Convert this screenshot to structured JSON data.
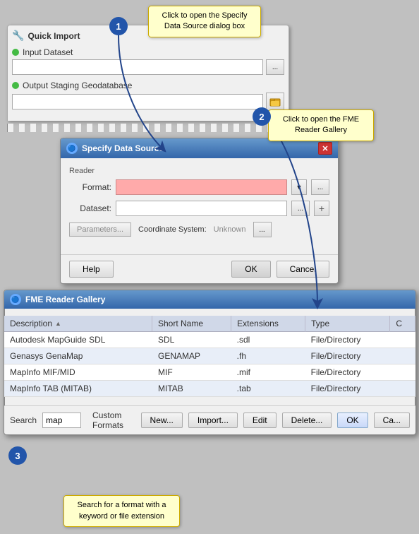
{
  "quickImport": {
    "title": "Quick Import",
    "inputDatasetLabel": "Input Dataset",
    "outputStagingLabel": "Output Staging Geodatabase",
    "browseBtnLabel": "...",
    "iconBtnLabel": "📁"
  },
  "tooltip1": {
    "text": "Click to open the Specify Data Source dialog box"
  },
  "tooltip2": {
    "text": "Click to open the FME Reader Gallery"
  },
  "tooltip3": {
    "text": "Search for a format with a keyword or file extension"
  },
  "specifyDialog": {
    "title": "Specify Data Source",
    "readerLabel": "Reader",
    "formatLabel": "Format:",
    "datasetLabel": "Dataset:",
    "paramsBtnLabel": "Parameters...",
    "coordinateSystemLabel": "Coordinate System:",
    "coordinateSystemValue": "Unknown",
    "browseBtnLabel": "...",
    "helpBtnLabel": "Help",
    "okBtnLabel": "OK",
    "cancelBtnLabel": "Cancel"
  },
  "readerGallery": {
    "title": "FME Reader Gallery",
    "columns": {
      "description": "Description",
      "shortName": "Short Name",
      "extensions": "Extensions",
      "type": "Type",
      "c": "C"
    },
    "rows": [
      {
        "description": "Autodesk MapGuide SDL",
        "shortName": "SDL",
        "extensions": ".sdl",
        "type": "File/Directory"
      },
      {
        "description": "Genasys GenaMap",
        "shortName": "GENAMAP",
        "extensions": ".fh",
        "type": "File/Directory"
      },
      {
        "description": "MapInfo MIF/MID",
        "shortName": "MIF",
        "extensions": ".mif",
        "type": "File/Directory"
      },
      {
        "description": "MapInfo TAB (MITAB)",
        "shortName": "MITAB",
        "extensions": ".tab",
        "type": "File/Directory"
      }
    ],
    "searchLabel": "Search",
    "searchValue": "map",
    "customFormatsLabel": "Custom Formats",
    "newBtnLabel": "New...",
    "importBtnLabel": "Import...",
    "editBtnLabel": "Edit",
    "deleteBtnLabel": "Delete...",
    "okBtnLabel": "OK",
    "cancelBtnLabel": "Ca..."
  },
  "circleNums": [
    "1",
    "2",
    "3"
  ]
}
